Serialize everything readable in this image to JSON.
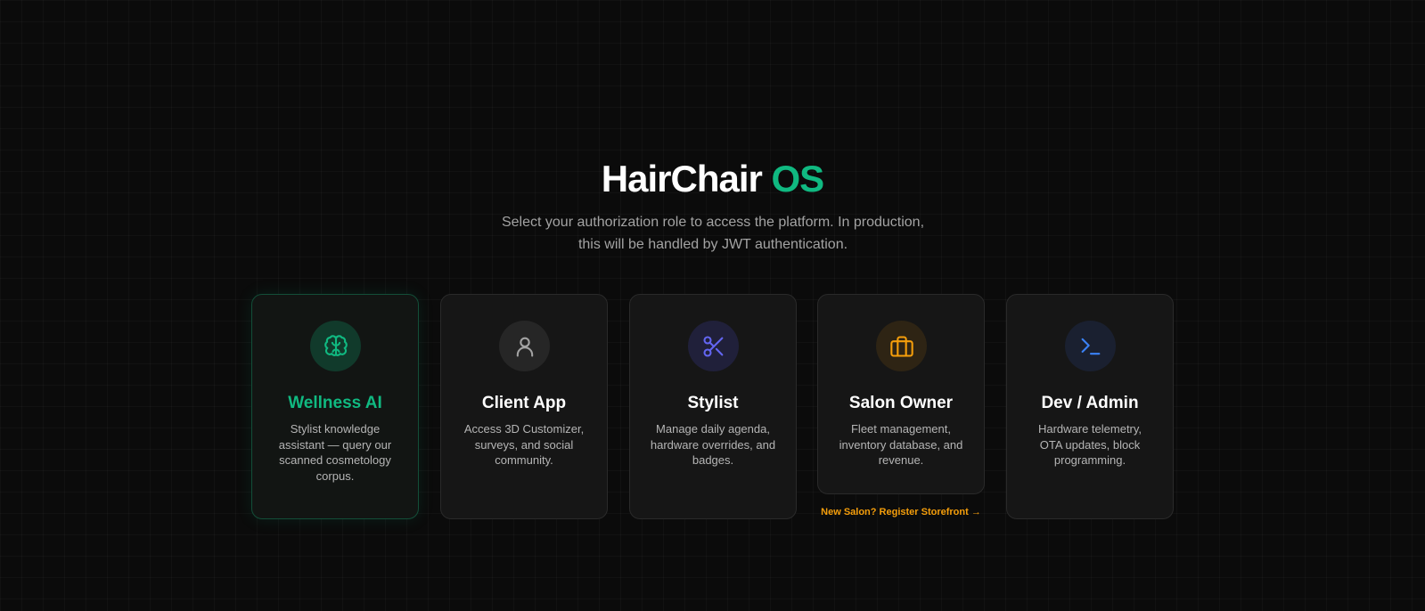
{
  "header": {
    "title_main": "HairChair",
    "title_accent": "OS",
    "subtitle_line1": "Select your authorization role to access the platform. In production,",
    "subtitle_line2": "this will be handled by JWT authentication."
  },
  "roles": [
    {
      "title": "Wellness AI",
      "description": "Stylist knowledge assistant — query our scanned cosmetology corpus.",
      "icon": "brain-icon",
      "accent": "#10b981",
      "selected": true
    },
    {
      "title": "Client App",
      "description": "Access 3D Customizer, surveys, and social community.",
      "icon": "user-icon",
      "accent": "#a3a3a3"
    },
    {
      "title": "Stylist",
      "description": "Manage daily agenda, hardware overrides, and badges.",
      "icon": "scissors-icon",
      "accent": "#6366f1"
    },
    {
      "title": "Salon Owner",
      "description": "Fleet management, inventory database, and revenue.",
      "icon": "briefcase-icon",
      "accent": "#f59e0b"
    },
    {
      "title": "Dev / Admin",
      "description": "Hardware telemetry, OTA updates, block programming.",
      "icon": "terminal-icon",
      "accent": "#3b82f6"
    }
  ],
  "register_link": "New Salon? Register Storefront →"
}
